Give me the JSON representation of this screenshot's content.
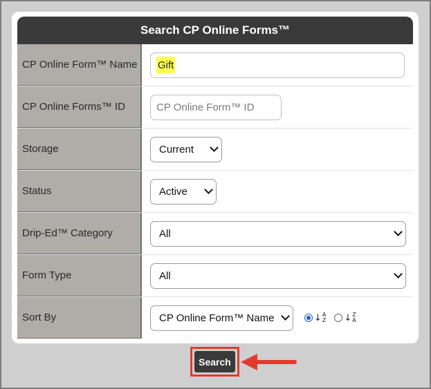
{
  "header": {
    "title": "Search CP Online Forms™"
  },
  "fields": {
    "form_name": {
      "label": "CP Online Form™ Name",
      "value": "Gift"
    },
    "form_id": {
      "label": "CP Online Forms™ ID",
      "placeholder": "CP Online Form™ ID"
    },
    "storage": {
      "label": "Storage",
      "selected": "Current"
    },
    "status": {
      "label": "Status",
      "selected": "Active"
    },
    "category": {
      "label": "Drip-Ed™ Category",
      "selected": "All"
    },
    "form_type": {
      "label": "Form Type",
      "selected": "All"
    },
    "sort_by": {
      "label": "Sort By",
      "selected": "CP Online Form™ Name",
      "asc_top": "A",
      "asc_bottom": "Z",
      "desc_top": "Z",
      "desc_bottom": "A",
      "selected_order": "ascending"
    }
  },
  "actions": {
    "search_label": "Search"
  },
  "colors": {
    "header_bg": "#3a3a3a",
    "label_bg": "#b0aca8",
    "highlight": "#ffff55",
    "annotation_red": "#e23b2e",
    "radio_blue": "#1a5bd6"
  }
}
